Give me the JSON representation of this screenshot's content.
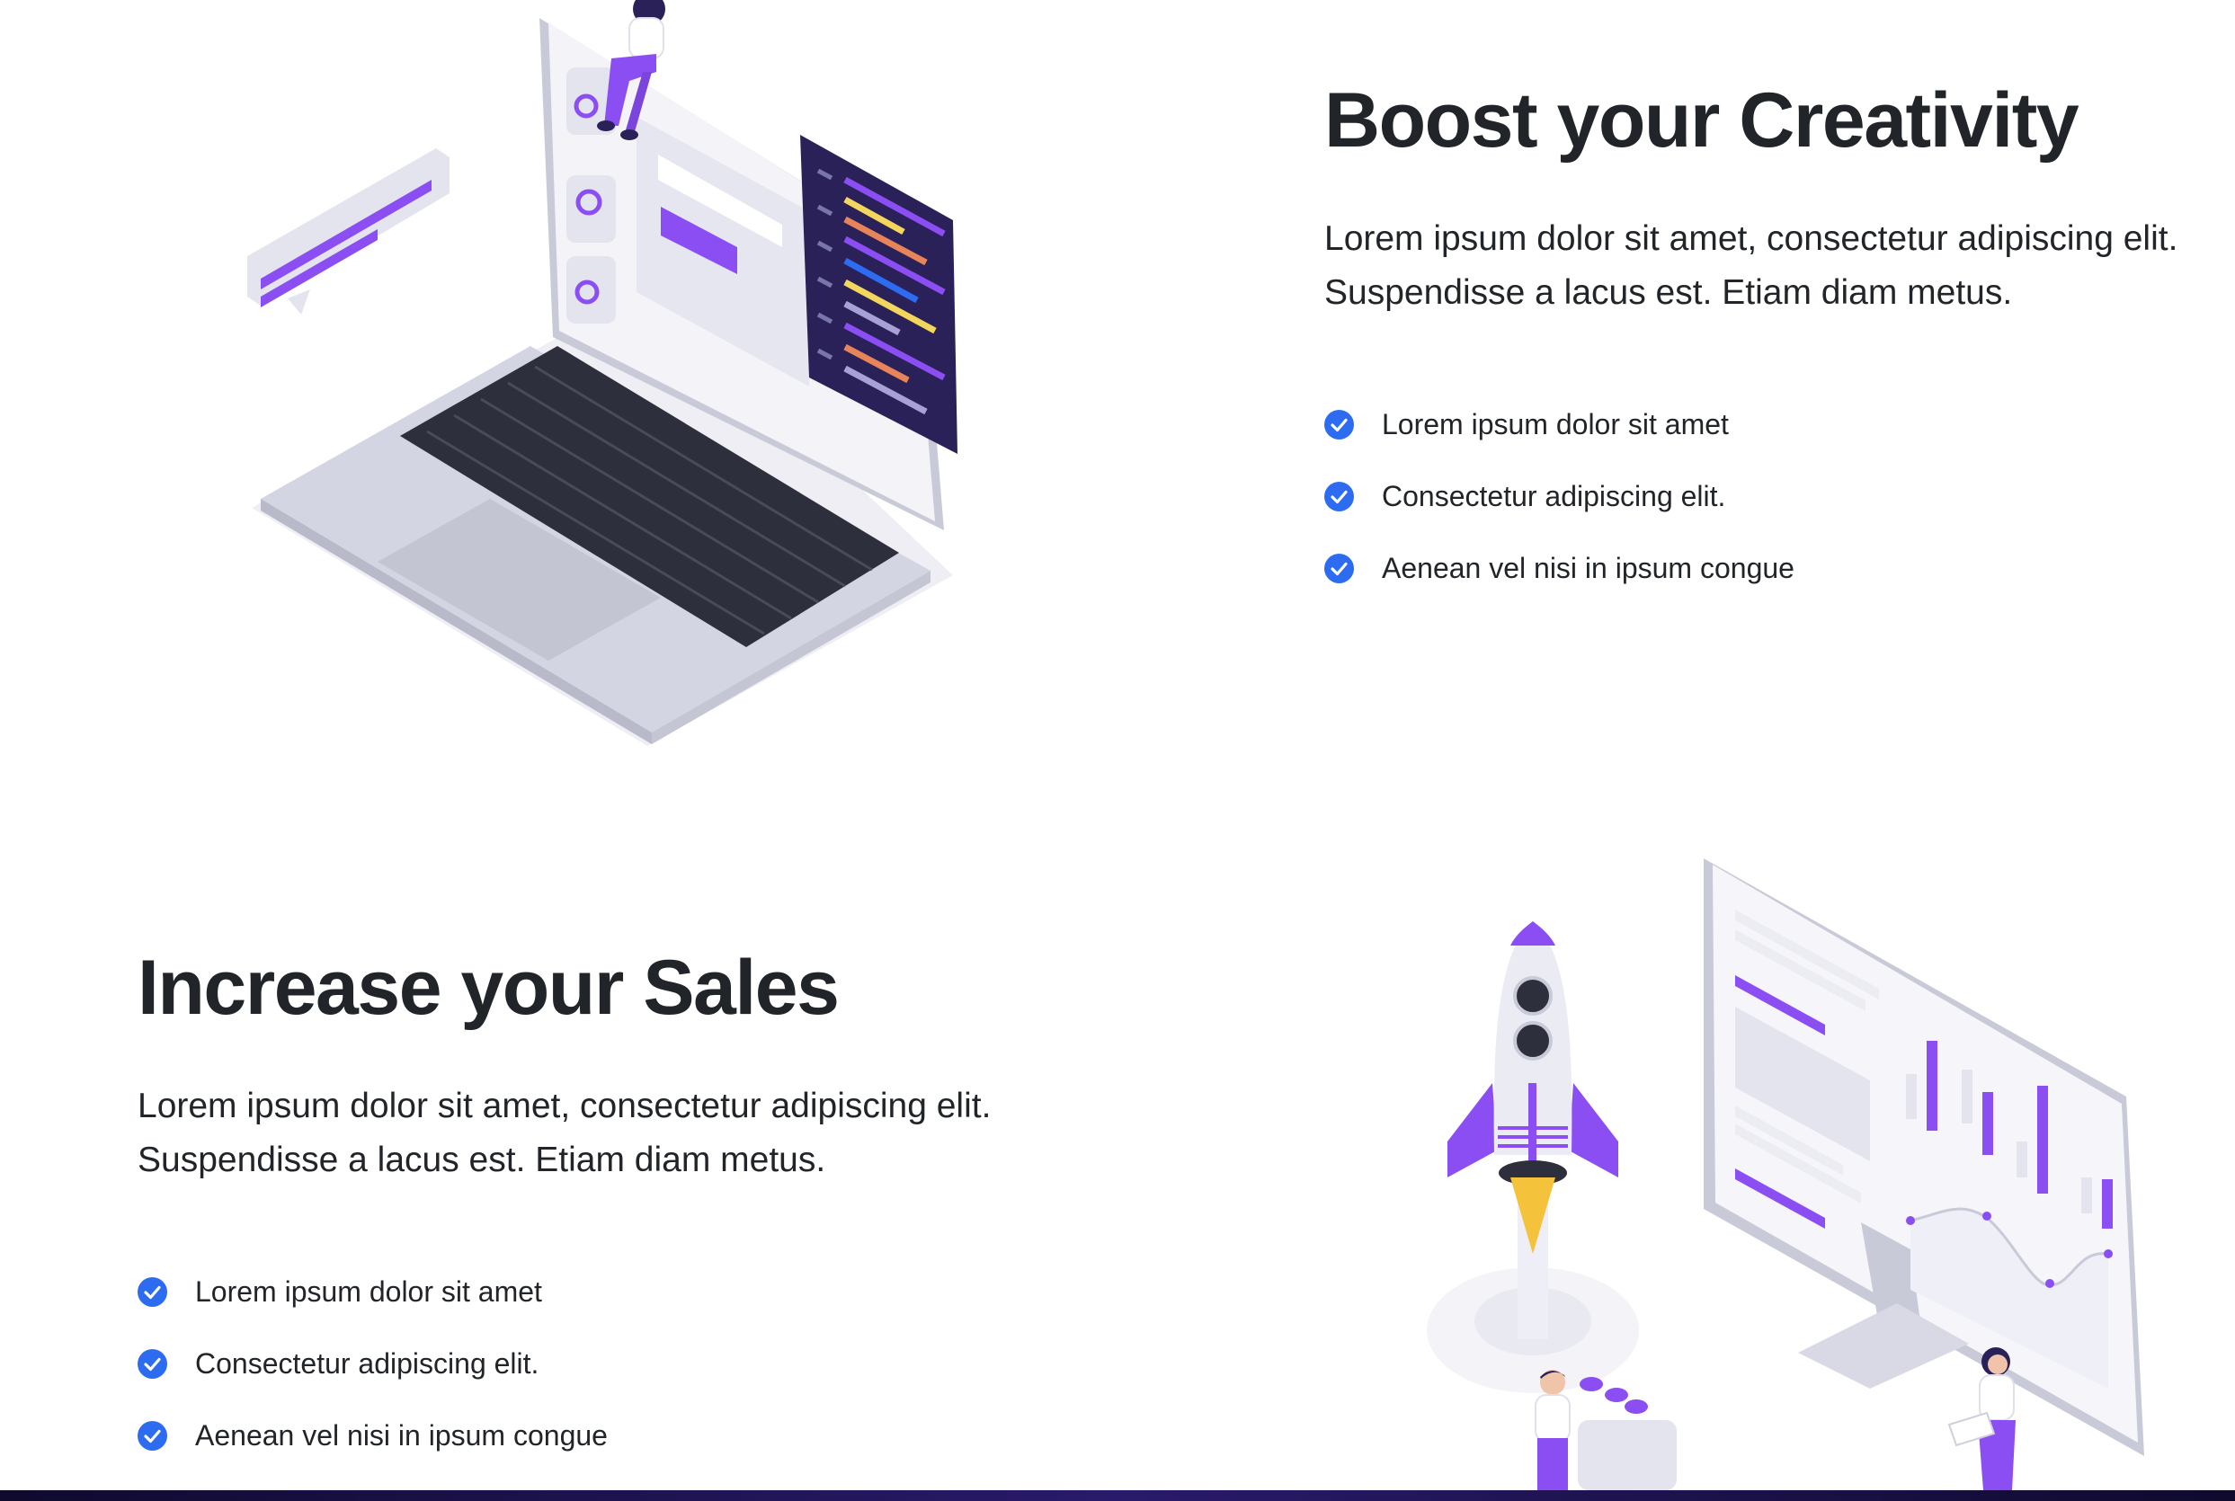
{
  "colors": {
    "text": "#212529",
    "check": "#2d6cf0",
    "accent_purple": "#8a4ef3",
    "panel_dark": "#2a2158",
    "device_grey": "#d6d7e3"
  },
  "icons": {
    "check": "check-circle-icon",
    "laptop": "laptop-illustration",
    "rocket": "rocket-illustration"
  },
  "sections": [
    {
      "title": "Boost your Creativity",
      "description_line1": "Lorem ipsum dolor sit amet, consectetur adipiscing elit.",
      "description_line2": "Suspendisse a lacus est. Etiam diam metus.",
      "items": [
        "Lorem ipsum dolor sit amet",
        "Consectetur adipiscing elit.",
        "Aenean vel nisi in ipsum congue"
      ]
    },
    {
      "title": "Increase your Sales",
      "description_line1": "Lorem ipsum dolor sit amet, consectetur adipiscing elit.",
      "description_line2": "Suspendisse a lacus est. Etiam diam metus.",
      "items": [
        "Lorem ipsum dolor sit amet",
        "Consectetur adipiscing elit.",
        "Aenean vel nisi in ipsum congue"
      ]
    }
  ]
}
